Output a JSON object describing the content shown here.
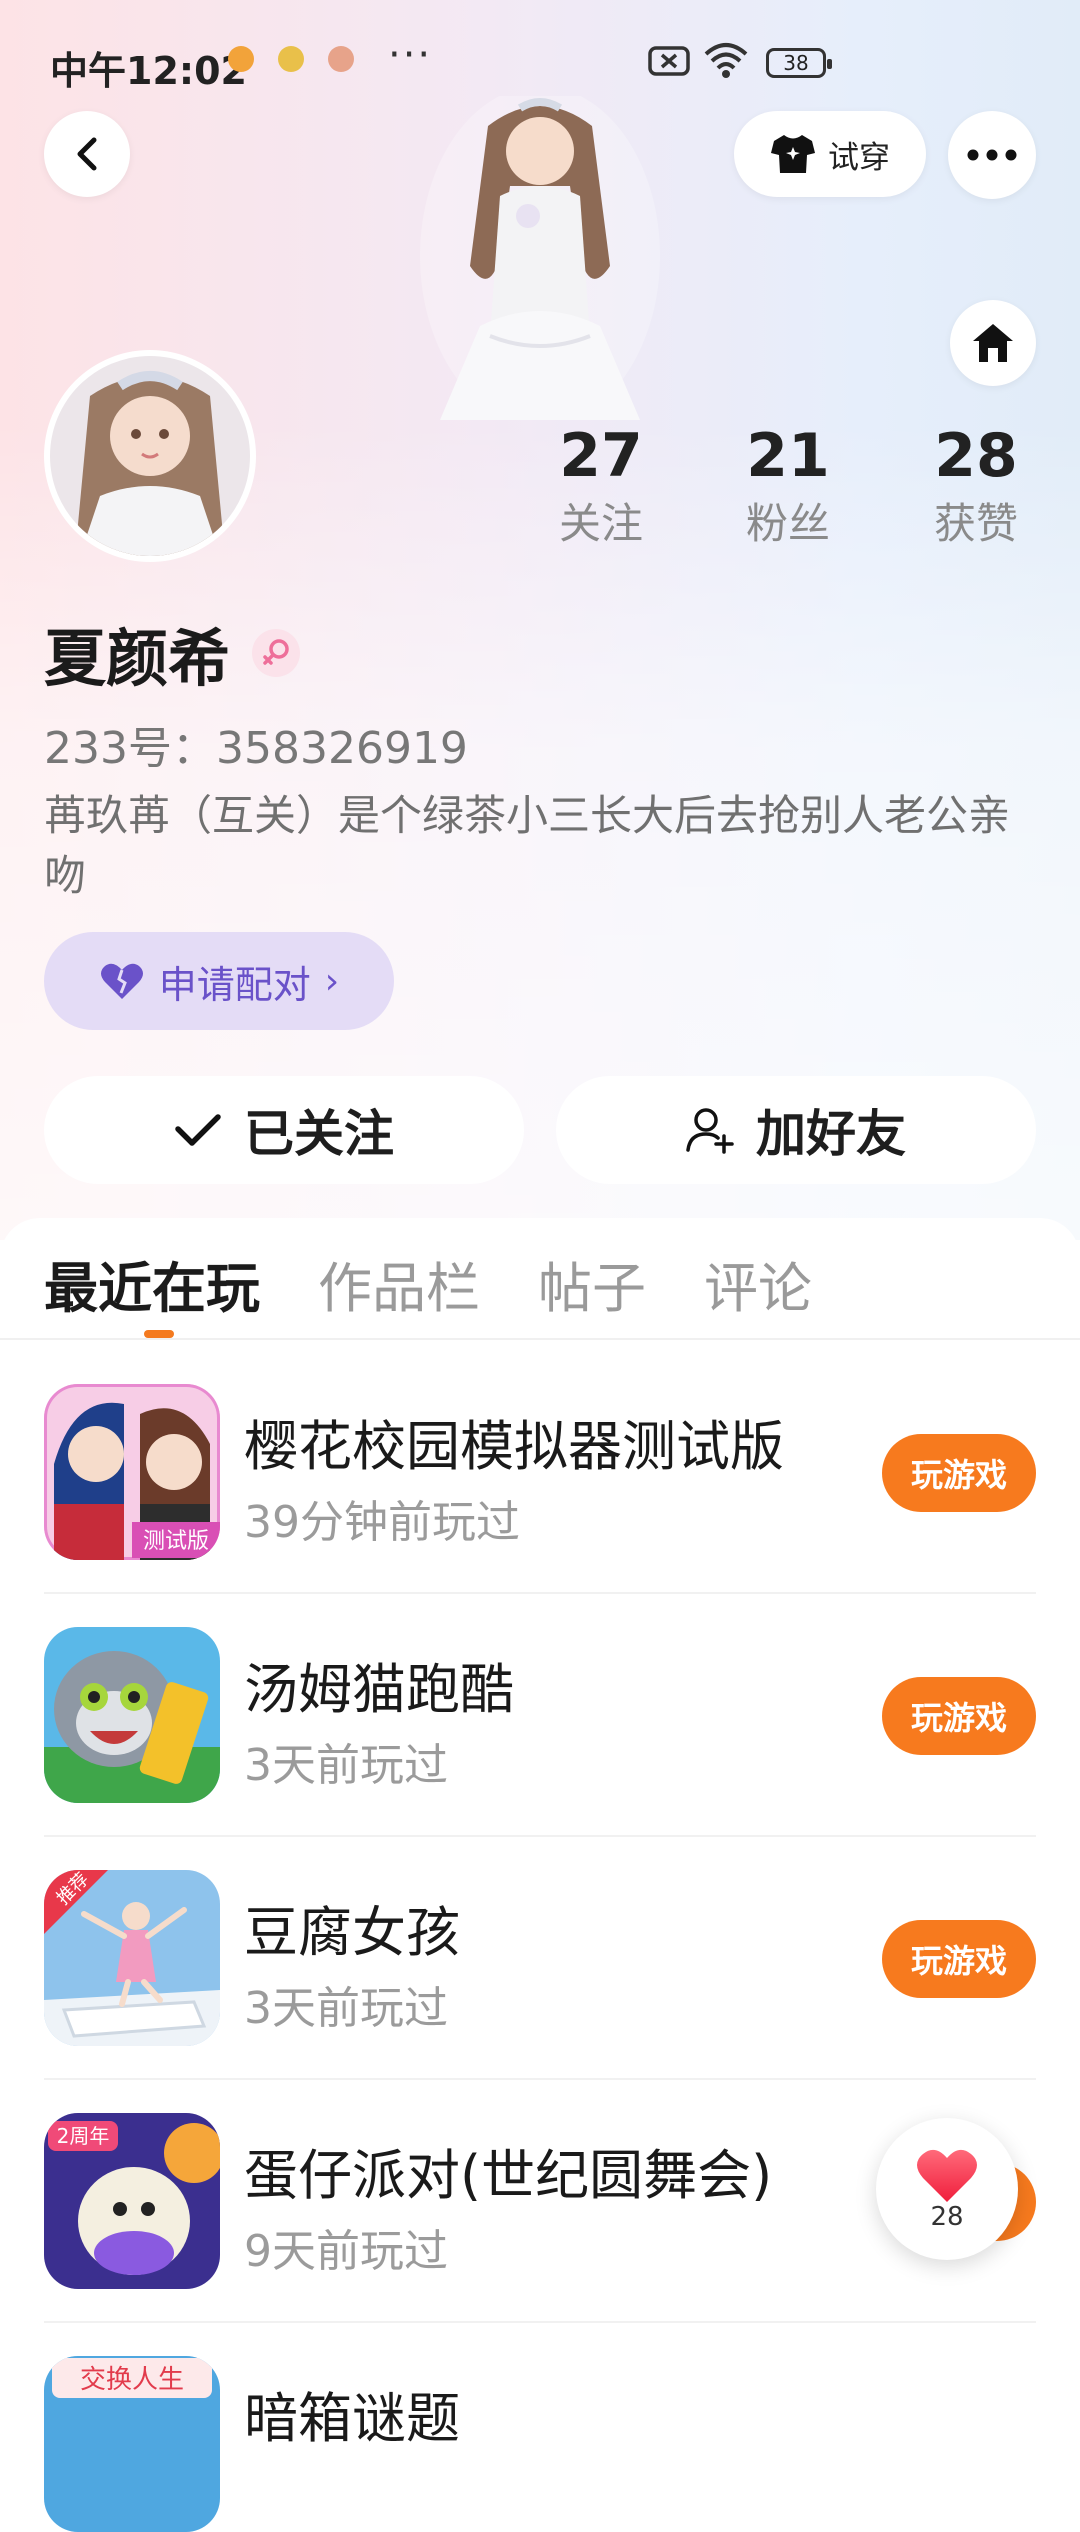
{
  "status_bar": {
    "time": "中午12:02",
    "more": "···",
    "battery": "38"
  },
  "header": {
    "tryon_label": "试穿"
  },
  "profile": {
    "name": "夏颜希",
    "uid": "233号：358326919",
    "bio": "苒玖苒（互关）是个绿茶小三长大后去抢别人老公亲吻",
    "pair_label": "申请配对"
  },
  "stats": [
    {
      "value": "27",
      "label": "关注"
    },
    {
      "value": "21",
      "label": "粉丝"
    },
    {
      "value": "28",
      "label": "获赞"
    }
  ],
  "actions": {
    "following": "已关注",
    "add_friend": "加好友"
  },
  "tabs": [
    {
      "label": "最近在玩",
      "active": true
    },
    {
      "label": "作品栏",
      "active": false
    },
    {
      "label": "帖子",
      "active": false
    },
    {
      "label": "评论",
      "active": false
    }
  ],
  "games": [
    {
      "title": "樱花校园模拟器测试版",
      "meta": "39分钟前玩过",
      "button": "玩游戏",
      "icon_badge": "测试版"
    },
    {
      "title": "汤姆猫跑酷",
      "meta": "3天前玩过",
      "button": "玩游戏"
    },
    {
      "title": "豆腐女孩",
      "meta": "3天前玩过",
      "button": "玩游戏",
      "icon_badge": "推荐"
    },
    {
      "title": "蛋仔派对(世纪圆舞会)",
      "meta": "9天前玩过",
      "button": "玩游戏",
      "icon_badge": "2周年"
    },
    {
      "title": "暗箱谜题",
      "icon_badge": "交换人生"
    }
  ],
  "float_like": {
    "count": "28"
  },
  "colors": {
    "accent": "#f77a1e",
    "pair_bg": "#e4dcf6",
    "pair_text": "#6a52c9"
  }
}
